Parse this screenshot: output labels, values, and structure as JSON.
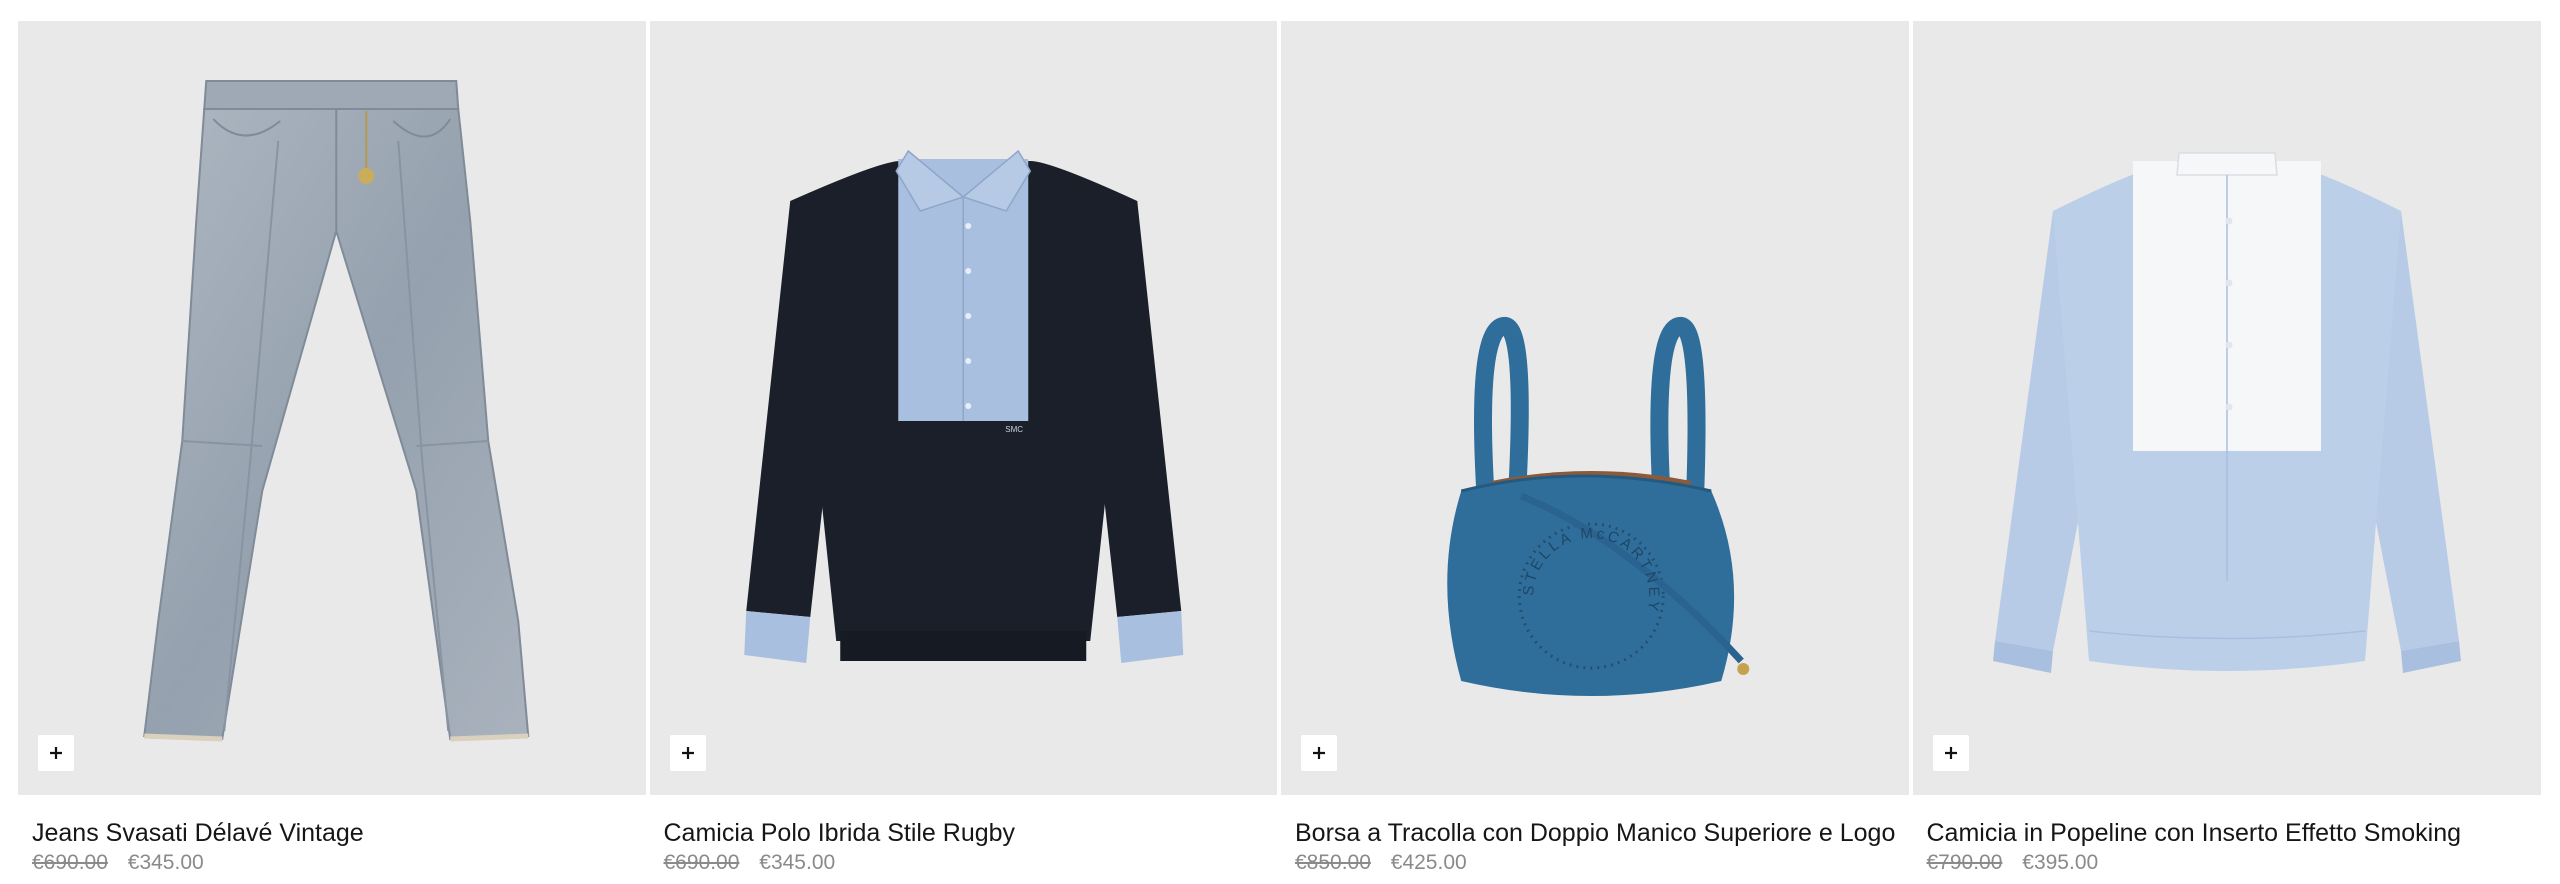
{
  "products": [
    {
      "name": "Jeans Svasati Délavé Vintage",
      "original_price": "€690.00",
      "sale_price": "€345.00",
      "image_icon": "flared-jeans-image"
    },
    {
      "name": "Camicia Polo Ibrida Stile Rugby",
      "original_price": "€690.00",
      "sale_price": "€345.00",
      "image_icon": "rugby-polo-shirt-image",
      "logo_text": "SMC"
    },
    {
      "name": "Borsa a Tracolla con Doppio Manico Superiore e Logo",
      "original_price": "€850.00",
      "sale_price": "€425.00",
      "image_icon": "blue-shoulder-bag-image",
      "logo_text": "STELLA McCARTNEY"
    },
    {
      "name": "Camicia in Popeline con Inserto Effetto Smoking",
      "original_price": "€790.00",
      "sale_price": "€395.00",
      "image_icon": "tuxedo-bib-shirt-image"
    }
  ],
  "add_button_icon": "plus-icon",
  "colors": {
    "card_background": "#e9e9e9",
    "strikethrough_price": "#8a8a8a",
    "text": "#161616"
  }
}
